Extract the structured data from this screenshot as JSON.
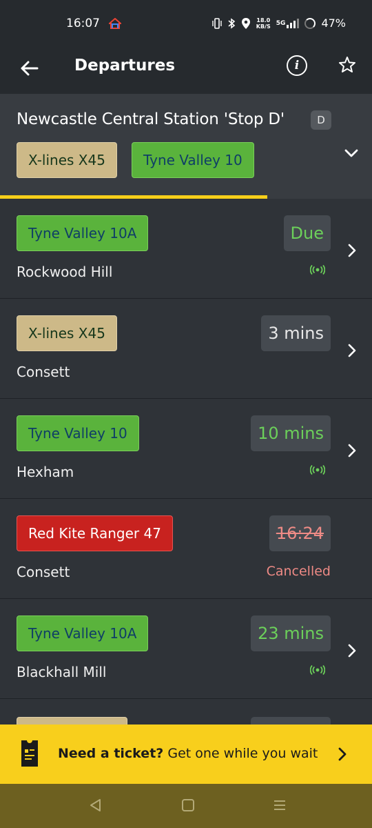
{
  "status": {
    "time": "16:07",
    "speed_top": "18.0",
    "speed_bottom": "KB/S",
    "network": "5G",
    "battery": "47%"
  },
  "header": {
    "title": "Departures"
  },
  "stop": {
    "name": "Newcastle Central Station 'Stop D'",
    "letter": "D",
    "routes": [
      {
        "label": "X-lines X45",
        "style": "tan"
      },
      {
        "label": "Tyne Valley 10",
        "style": "green"
      }
    ]
  },
  "departures": [
    {
      "route": "Tyne Valley 10A",
      "route_style": "green",
      "destination": "Rockwood Hill",
      "time": "Due",
      "time_style": "green",
      "live": true,
      "cancelled_label": ""
    },
    {
      "route": "X-lines X45",
      "route_style": "tan",
      "destination": "Consett",
      "time": "3 mins",
      "time_style": "white",
      "live": false,
      "cancelled_label": ""
    },
    {
      "route": "Tyne Valley 10",
      "route_style": "green",
      "destination": "Hexham",
      "time": "10 mins",
      "time_style": "green",
      "live": true,
      "cancelled_label": ""
    },
    {
      "route": "Red Kite Ranger 47",
      "route_style": "red",
      "destination": "Consett",
      "time": "16:24",
      "time_style": "struck",
      "live": false,
      "cancelled_label": "Cancelled"
    },
    {
      "route": "Tyne Valley 10A",
      "route_style": "green",
      "destination": "Blackhall Mill",
      "time": "23 mins",
      "time_style": "green",
      "live": true,
      "cancelled_label": ""
    }
  ],
  "banner": {
    "bold": "Need a ticket?",
    "text": " Get one while you wait"
  },
  "colors": {
    "accent_yellow": "#f8cf1c",
    "live_green": "#6cd05a",
    "cancel_red": "#ee8a85"
  }
}
